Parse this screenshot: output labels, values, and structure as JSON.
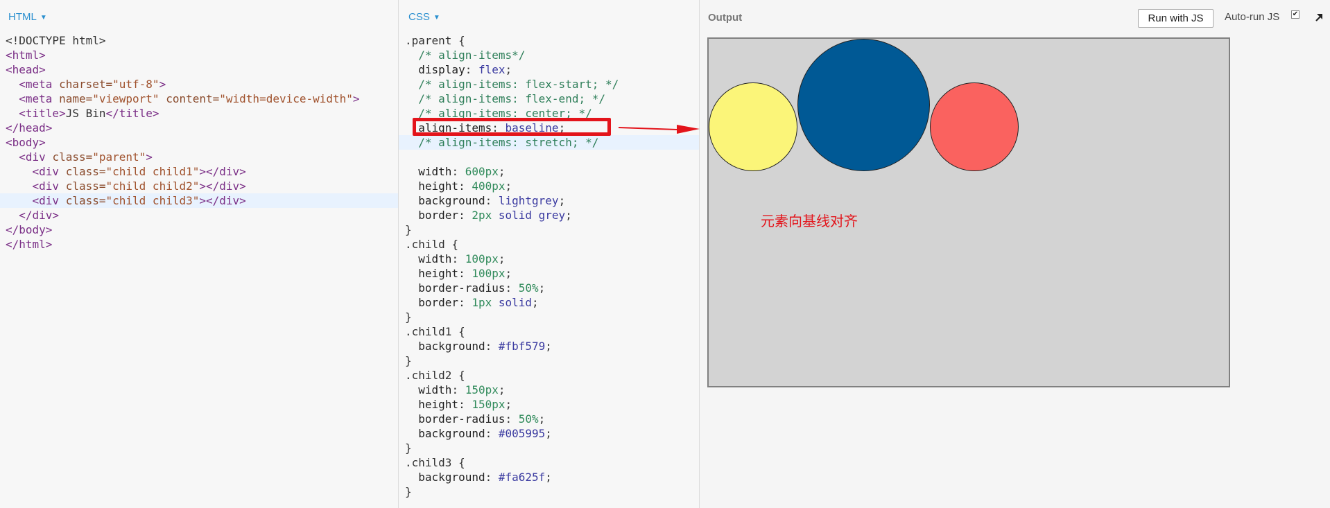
{
  "html_panel": {
    "label": "HTML",
    "lines": [
      [
        [
          "t-pun",
          "<!DOCTYPE html>"
        ]
      ],
      [
        [
          "t-tag",
          "<html>"
        ]
      ],
      [
        [
          "t-tag",
          "<head>"
        ]
      ],
      [
        [
          "t-pun",
          "  "
        ],
        [
          "t-tag",
          "<meta "
        ],
        [
          "t-attr",
          "charset="
        ],
        [
          "t-str",
          "\"utf-8\""
        ],
        [
          "t-tag",
          ">"
        ]
      ],
      [
        [
          "t-pun",
          "  "
        ],
        [
          "t-tag",
          "<meta "
        ],
        [
          "t-attr",
          "name="
        ],
        [
          "t-str",
          "\"viewport\" "
        ],
        [
          "t-attr",
          "content="
        ],
        [
          "t-str",
          "\"width=device-width\""
        ],
        [
          "t-tag",
          ">"
        ]
      ],
      [
        [
          "t-pun",
          "  "
        ],
        [
          "t-tag",
          "<title>"
        ],
        [
          "t-text",
          "JS Bin"
        ],
        [
          "t-tag",
          "</title>"
        ]
      ],
      [
        [
          "t-tag",
          "</head>"
        ]
      ],
      [
        [
          "t-tag",
          "<body>"
        ]
      ],
      [
        [
          "t-pun",
          "  "
        ],
        [
          "t-tag",
          "<div "
        ],
        [
          "t-attr",
          "class="
        ],
        [
          "t-str",
          "\"parent\""
        ],
        [
          "t-tag",
          ">"
        ]
      ],
      [
        [
          "t-pun",
          "    "
        ],
        [
          "t-tag",
          "<div "
        ],
        [
          "t-attr",
          "class="
        ],
        [
          "t-str",
          "\"child child1\""
        ],
        [
          "t-tag",
          "></div>"
        ]
      ],
      [
        [
          "t-pun",
          "    "
        ],
        [
          "t-tag",
          "<div "
        ],
        [
          "t-attr",
          "class="
        ],
        [
          "t-str",
          "\"child child2\""
        ],
        [
          "t-tag",
          "></div>"
        ]
      ],
      [
        [
          "t-pun",
          "    "
        ],
        [
          "t-tag",
          "<div "
        ],
        [
          "t-attr",
          "class="
        ],
        [
          "t-str",
          "\"child child3\""
        ],
        [
          "t-tag",
          "></div>"
        ]
      ],
      [
        [
          "t-pun",
          "  "
        ],
        [
          "t-tag",
          "</div>"
        ]
      ],
      [
        [
          "t-tag",
          "</body>"
        ]
      ],
      [
        [
          "t-tag",
          "</html>"
        ]
      ]
    ],
    "active_line": 11
  },
  "css_panel": {
    "label": "CSS",
    "lines": [
      [
        [
          "t-sel",
          ".parent {"
        ]
      ],
      [
        [
          "t-com",
          "  /* align-items*/"
        ]
      ],
      [
        [
          "t-prop",
          "  display"
        ],
        [
          "t-pun",
          ": "
        ],
        [
          "t-val",
          "flex"
        ],
        [
          "t-pun",
          ";"
        ]
      ],
      [
        [
          "t-com",
          "  /* align-items: flex-start; */"
        ]
      ],
      [
        [
          "t-com",
          "  /* align-items: flex-end; */"
        ]
      ],
      [
        [
          "t-com",
          "  /* align-items: center; */"
        ]
      ],
      [
        [
          "t-prop",
          "  align-items"
        ],
        [
          "t-pun",
          ": "
        ],
        [
          "t-val",
          "baseline"
        ],
        [
          "t-pun",
          ";"
        ]
      ],
      [
        [
          "t-com",
          "  /* align-items: stretch; */"
        ]
      ],
      [
        [
          "t-pun",
          ""
        ]
      ],
      [
        [
          "t-prop",
          "  width"
        ],
        [
          "t-pun",
          ": "
        ],
        [
          "t-num",
          "600px"
        ],
        [
          "t-pun",
          ";"
        ]
      ],
      [
        [
          "t-prop",
          "  height"
        ],
        [
          "t-pun",
          ": "
        ],
        [
          "t-num",
          "400px"
        ],
        [
          "t-pun",
          ";"
        ]
      ],
      [
        [
          "t-prop",
          "  background"
        ],
        [
          "t-pun",
          ": "
        ],
        [
          "t-val",
          "lightgrey"
        ],
        [
          "t-pun",
          ";"
        ]
      ],
      [
        [
          "t-prop",
          "  border"
        ],
        [
          "t-pun",
          ": "
        ],
        [
          "t-num",
          "2px "
        ],
        [
          "t-val",
          "solid grey"
        ],
        [
          "t-pun",
          ";"
        ]
      ],
      [
        [
          "t-sel",
          "}"
        ]
      ],
      [
        [
          "t-sel",
          ".child {"
        ]
      ],
      [
        [
          "t-prop",
          "  width"
        ],
        [
          "t-pun",
          ": "
        ],
        [
          "t-num",
          "100px"
        ],
        [
          "t-pun",
          ";"
        ]
      ],
      [
        [
          "t-prop",
          "  height"
        ],
        [
          "t-pun",
          ": "
        ],
        [
          "t-num",
          "100px"
        ],
        [
          "t-pun",
          ";"
        ]
      ],
      [
        [
          "t-prop",
          "  border-radius"
        ],
        [
          "t-pun",
          ": "
        ],
        [
          "t-num",
          "50%"
        ],
        [
          "t-pun",
          ";"
        ]
      ],
      [
        [
          "t-prop",
          "  border"
        ],
        [
          "t-pun",
          ": "
        ],
        [
          "t-num",
          "1px "
        ],
        [
          "t-val",
          "solid"
        ],
        [
          "t-pun",
          ";"
        ]
      ],
      [
        [
          "t-sel",
          "}"
        ]
      ],
      [
        [
          "t-sel",
          ".child1 {"
        ]
      ],
      [
        [
          "t-prop",
          "  background"
        ],
        [
          "t-pun",
          ": "
        ],
        [
          "t-val",
          "#fbf579"
        ],
        [
          "t-pun",
          ";"
        ]
      ],
      [
        [
          "t-sel",
          "}"
        ]
      ],
      [
        [
          "t-sel",
          ".child2 {"
        ]
      ],
      [
        [
          "t-prop",
          "  width"
        ],
        [
          "t-pun",
          ": "
        ],
        [
          "t-num",
          "150px"
        ],
        [
          "t-pun",
          ";"
        ]
      ],
      [
        [
          "t-prop",
          "  height"
        ],
        [
          "t-pun",
          ": "
        ],
        [
          "t-num",
          "150px"
        ],
        [
          "t-pun",
          ";"
        ]
      ],
      [
        [
          "t-prop",
          "  border-radius"
        ],
        [
          "t-pun",
          ": "
        ],
        [
          "t-num",
          "50%"
        ],
        [
          "t-pun",
          ";"
        ]
      ],
      [
        [
          "t-prop",
          "  background"
        ],
        [
          "t-pun",
          ": "
        ],
        [
          "t-val",
          "#005995"
        ],
        [
          "t-pun",
          ";"
        ]
      ],
      [
        [
          "t-sel",
          "}"
        ]
      ],
      [
        [
          "t-sel",
          ".child3 {"
        ]
      ],
      [
        [
          "t-prop",
          "  background"
        ],
        [
          "t-pun",
          ": "
        ],
        [
          "t-val",
          "#fa625f"
        ],
        [
          "t-pun",
          ";"
        ]
      ],
      [
        [
          "t-sel",
          "}"
        ]
      ]
    ],
    "active_line": 7
  },
  "output_panel": {
    "label": "Output",
    "run_button": "Run with JS",
    "autorun_label": "Auto-run JS",
    "autorun_checked": true,
    "annotation": "元素向基线对齐"
  },
  "colors": {
    "accent": "#2a8fcf",
    "highlight": "#e3141b",
    "child1": "#fbf579",
    "child2": "#005995",
    "child3": "#fa625f",
    "stage_bg": "lightgrey",
    "stage_border": "grey"
  },
  "icons": {
    "popout": "popout-arrow-icon",
    "dropdown": "caret-down-icon"
  }
}
